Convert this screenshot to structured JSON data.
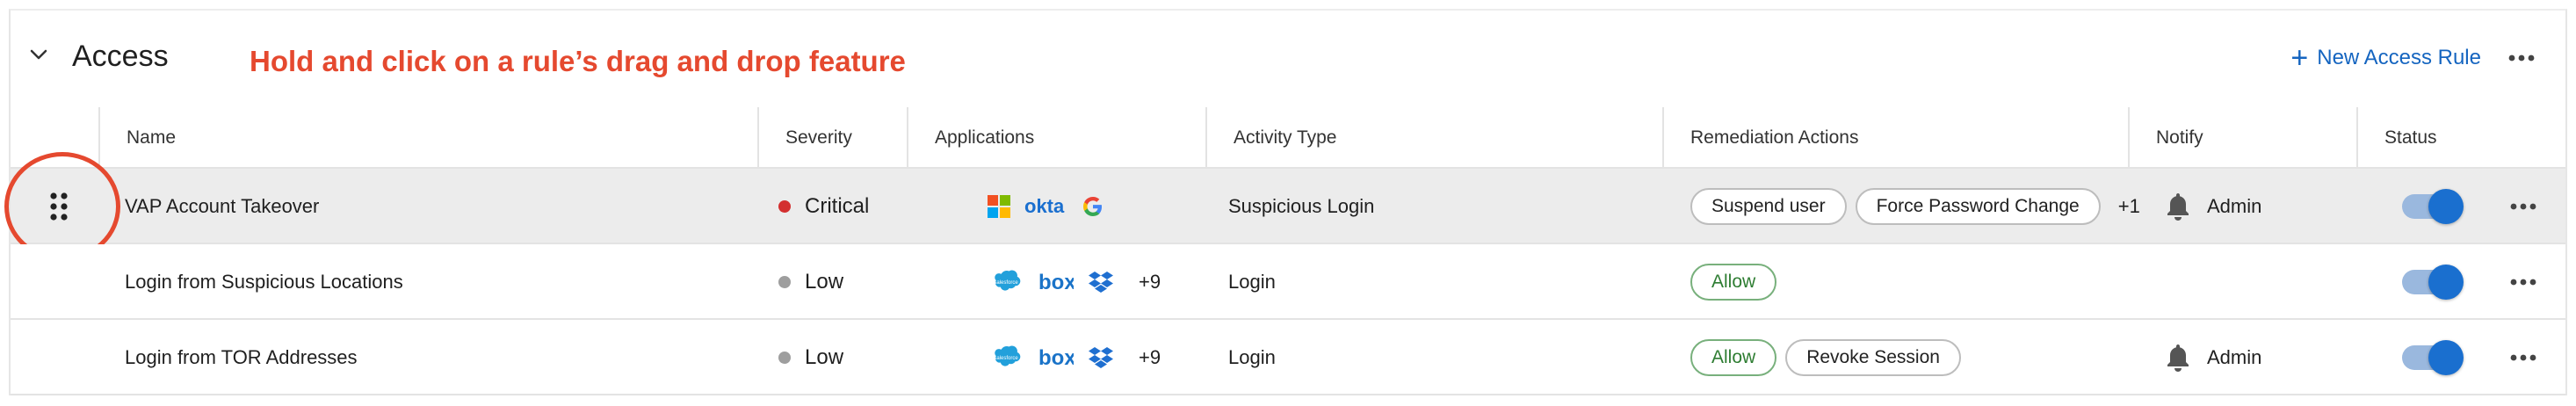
{
  "section": {
    "title": "Access",
    "annotation": "Hold and click on a rule’s drag and drop feature",
    "new_rule_label": "New Access Rule",
    "accent_color": "#1565c0",
    "annotation_color": "#e5492f"
  },
  "columns": [
    "Name",
    "Severity",
    "Applications",
    "Activity Type",
    "Remediation Actions",
    "Notify",
    "Status"
  ],
  "rows": [
    {
      "name": "VAP Account Takeover",
      "severity": "Critical",
      "severity_color": "#d32f2f",
      "apps": [
        "microsoft",
        "okta",
        "google"
      ],
      "apps_more": "",
      "activity": "Suspicious Login",
      "actions": [
        {
          "label": "Suspend user",
          "kind": "neutral"
        },
        {
          "label": "Force Password Change",
          "kind": "neutral"
        }
      ],
      "actions_more": "+1",
      "notify": "Admin",
      "status_on": true,
      "selected": true
    },
    {
      "name": "Login from Suspicious Locations",
      "severity": "Low",
      "severity_color": "#9e9e9e",
      "apps": [
        "salesforce",
        "box",
        "dropbox"
      ],
      "apps_more": "+9",
      "activity": "Login",
      "actions": [
        {
          "label": "Allow",
          "kind": "allow"
        }
      ],
      "actions_more": "",
      "notify": "",
      "status_on": true,
      "selected": false
    },
    {
      "name": "Login from TOR Addresses",
      "severity": "Low",
      "severity_color": "#9e9e9e",
      "apps": [
        "salesforce",
        "box",
        "dropbox"
      ],
      "apps_more": "+9",
      "activity": "Login",
      "actions": [
        {
          "label": "Allow",
          "kind": "allow"
        },
        {
          "label": "Revoke Session",
          "kind": "neutral"
        }
      ],
      "actions_more": "",
      "notify": "Admin",
      "status_on": true,
      "selected": false
    }
  ],
  "icon_names": {
    "chevron": "chevron-down-icon",
    "plus": "plus-icon",
    "more": "more-horizontal-icon",
    "drag": "drag-handle-icon",
    "bell": "bell-icon"
  }
}
